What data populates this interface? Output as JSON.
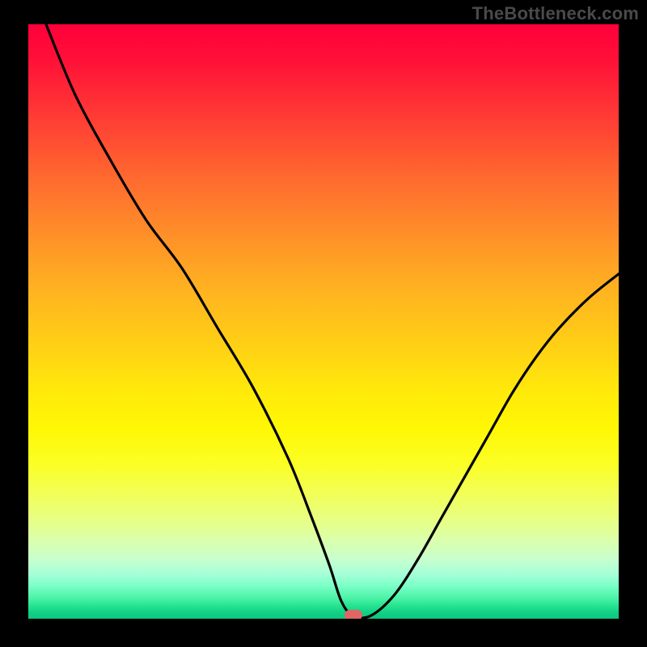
{
  "watermark": "TheBottleneck.com",
  "colors": {
    "frame": "#000000",
    "curve": "#000000",
    "marker": "#e06666",
    "gradient_stops": [
      "#ff003a",
      "#ff1038",
      "#ff3d34",
      "#ff6a2f",
      "#ff8a2a",
      "#ffb021",
      "#ffd015",
      "#ffea0a",
      "#fff705",
      "#fbff25",
      "#f2ff58",
      "#e8ff80",
      "#daffae",
      "#c8ffce",
      "#a6ffd8",
      "#7affc7",
      "#4cf3a8",
      "#22e18e",
      "#11cf84",
      "#0cc781"
    ]
  },
  "chart_data": {
    "type": "line",
    "title": "",
    "xlabel": "",
    "ylabel": "",
    "xlim": [
      0,
      100
    ],
    "ylim": [
      0,
      100
    ],
    "grid": false,
    "legend": false,
    "note": "Axes are unlabeled in the image; values are normalized 0–100 estimates read from pixel positions. Curve resembles a bottleneck percentage vs. component performance.",
    "marker": {
      "x": 55,
      "y": 0.5,
      "color": "#e06666"
    },
    "series": [
      {
        "name": "curve",
        "x": [
          3,
          8,
          14,
          20,
          26,
          32,
          38,
          44,
          48,
          51,
          53,
          55,
          58,
          62,
          66,
          70,
          74,
          78,
          82,
          86,
          90,
          95,
          100
        ],
        "y": [
          100,
          88,
          77,
          67,
          59,
          49,
          39,
          27,
          17,
          9,
          3,
          0.5,
          0.5,
          4,
          10,
          17,
          24,
          31,
          38,
          44,
          49,
          54,
          58
        ]
      }
    ]
  }
}
